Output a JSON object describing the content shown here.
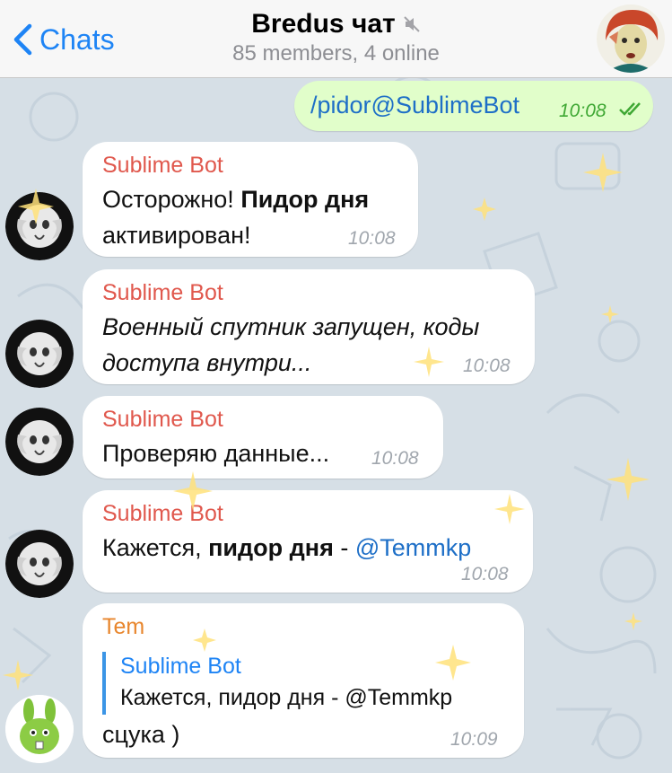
{
  "header": {
    "back_label": "Chats",
    "title": "Bredus чат",
    "subtitle": "85 members, 4 online",
    "mute_icon": "mute-icon",
    "avatar_icon": "user-avatar"
  },
  "messages": [
    {
      "direction": "out",
      "text": "/pidor@SublimeBot",
      "time": "10:08",
      "status": "read-double-check"
    },
    {
      "direction": "in",
      "sender": "Sublime Bot",
      "text_plain": "Осторожно! ",
      "text_bold": "Пидор дня",
      "text_after": " активирован!",
      "time": "10:08"
    },
    {
      "direction": "in",
      "sender": "Sublime Bot",
      "text_italic": "Военный спутник запущен, коды доступа внутри...",
      "time": "10:08"
    },
    {
      "direction": "in",
      "sender": "Sublime Bot",
      "text": "Проверяю данные...",
      "time": "10:08"
    },
    {
      "direction": "in",
      "sender": "Sublime Bot",
      "text_plain": "Кажется, ",
      "text_bold": "пидор дня",
      "text_after": " - ",
      "mention": "@Temmkp",
      "time": "10:08"
    },
    {
      "direction": "in",
      "sender": "Tem",
      "reply_name": "Sublime Bot",
      "reply_text": "Кажется, пидор дня - @Temmkp",
      "text": "сцука )",
      "time": "10:09"
    }
  ],
  "colors": {
    "accent": "#1e84f5",
    "bot_name": "#e0584d",
    "tem_name": "#e8862d",
    "outgoing_bubble": "#e1feca",
    "background": "#d6dfe6"
  }
}
